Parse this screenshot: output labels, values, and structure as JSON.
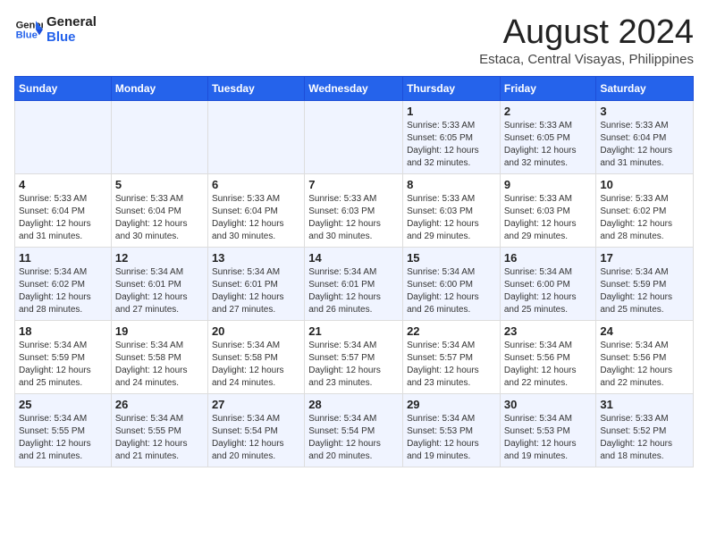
{
  "logo": {
    "line1": "General",
    "line2": "Blue"
  },
  "title": "August 2024",
  "subtitle": "Estaca, Central Visayas, Philippines",
  "days_header": [
    "Sunday",
    "Monday",
    "Tuesday",
    "Wednesday",
    "Thursday",
    "Friday",
    "Saturday"
  ],
  "weeks": [
    [
      {
        "num": "",
        "info": ""
      },
      {
        "num": "",
        "info": ""
      },
      {
        "num": "",
        "info": ""
      },
      {
        "num": "",
        "info": ""
      },
      {
        "num": "1",
        "info": "Sunrise: 5:33 AM\nSunset: 6:05 PM\nDaylight: 12 hours\nand 32 minutes."
      },
      {
        "num": "2",
        "info": "Sunrise: 5:33 AM\nSunset: 6:05 PM\nDaylight: 12 hours\nand 32 minutes."
      },
      {
        "num": "3",
        "info": "Sunrise: 5:33 AM\nSunset: 6:04 PM\nDaylight: 12 hours\nand 31 minutes."
      }
    ],
    [
      {
        "num": "4",
        "info": "Sunrise: 5:33 AM\nSunset: 6:04 PM\nDaylight: 12 hours\nand 31 minutes."
      },
      {
        "num": "5",
        "info": "Sunrise: 5:33 AM\nSunset: 6:04 PM\nDaylight: 12 hours\nand 30 minutes."
      },
      {
        "num": "6",
        "info": "Sunrise: 5:33 AM\nSunset: 6:04 PM\nDaylight: 12 hours\nand 30 minutes."
      },
      {
        "num": "7",
        "info": "Sunrise: 5:33 AM\nSunset: 6:03 PM\nDaylight: 12 hours\nand 30 minutes."
      },
      {
        "num": "8",
        "info": "Sunrise: 5:33 AM\nSunset: 6:03 PM\nDaylight: 12 hours\nand 29 minutes."
      },
      {
        "num": "9",
        "info": "Sunrise: 5:33 AM\nSunset: 6:03 PM\nDaylight: 12 hours\nand 29 minutes."
      },
      {
        "num": "10",
        "info": "Sunrise: 5:33 AM\nSunset: 6:02 PM\nDaylight: 12 hours\nand 28 minutes."
      }
    ],
    [
      {
        "num": "11",
        "info": "Sunrise: 5:34 AM\nSunset: 6:02 PM\nDaylight: 12 hours\nand 28 minutes."
      },
      {
        "num": "12",
        "info": "Sunrise: 5:34 AM\nSunset: 6:01 PM\nDaylight: 12 hours\nand 27 minutes."
      },
      {
        "num": "13",
        "info": "Sunrise: 5:34 AM\nSunset: 6:01 PM\nDaylight: 12 hours\nand 27 minutes."
      },
      {
        "num": "14",
        "info": "Sunrise: 5:34 AM\nSunset: 6:01 PM\nDaylight: 12 hours\nand 26 minutes."
      },
      {
        "num": "15",
        "info": "Sunrise: 5:34 AM\nSunset: 6:00 PM\nDaylight: 12 hours\nand 26 minutes."
      },
      {
        "num": "16",
        "info": "Sunrise: 5:34 AM\nSunset: 6:00 PM\nDaylight: 12 hours\nand 25 minutes."
      },
      {
        "num": "17",
        "info": "Sunrise: 5:34 AM\nSunset: 5:59 PM\nDaylight: 12 hours\nand 25 minutes."
      }
    ],
    [
      {
        "num": "18",
        "info": "Sunrise: 5:34 AM\nSunset: 5:59 PM\nDaylight: 12 hours\nand 25 minutes."
      },
      {
        "num": "19",
        "info": "Sunrise: 5:34 AM\nSunset: 5:58 PM\nDaylight: 12 hours\nand 24 minutes."
      },
      {
        "num": "20",
        "info": "Sunrise: 5:34 AM\nSunset: 5:58 PM\nDaylight: 12 hours\nand 24 minutes."
      },
      {
        "num": "21",
        "info": "Sunrise: 5:34 AM\nSunset: 5:57 PM\nDaylight: 12 hours\nand 23 minutes."
      },
      {
        "num": "22",
        "info": "Sunrise: 5:34 AM\nSunset: 5:57 PM\nDaylight: 12 hours\nand 23 minutes."
      },
      {
        "num": "23",
        "info": "Sunrise: 5:34 AM\nSunset: 5:56 PM\nDaylight: 12 hours\nand 22 minutes."
      },
      {
        "num": "24",
        "info": "Sunrise: 5:34 AM\nSunset: 5:56 PM\nDaylight: 12 hours\nand 22 minutes."
      }
    ],
    [
      {
        "num": "25",
        "info": "Sunrise: 5:34 AM\nSunset: 5:55 PM\nDaylight: 12 hours\nand 21 minutes."
      },
      {
        "num": "26",
        "info": "Sunrise: 5:34 AM\nSunset: 5:55 PM\nDaylight: 12 hours\nand 21 minutes."
      },
      {
        "num": "27",
        "info": "Sunrise: 5:34 AM\nSunset: 5:54 PM\nDaylight: 12 hours\nand 20 minutes."
      },
      {
        "num": "28",
        "info": "Sunrise: 5:34 AM\nSunset: 5:54 PM\nDaylight: 12 hours\nand 20 minutes."
      },
      {
        "num": "29",
        "info": "Sunrise: 5:34 AM\nSunset: 5:53 PM\nDaylight: 12 hours\nand 19 minutes."
      },
      {
        "num": "30",
        "info": "Sunrise: 5:34 AM\nSunset: 5:53 PM\nDaylight: 12 hours\nand 19 minutes."
      },
      {
        "num": "31",
        "info": "Sunrise: 5:33 AM\nSunset: 5:52 PM\nDaylight: 12 hours\nand 18 minutes."
      }
    ]
  ]
}
